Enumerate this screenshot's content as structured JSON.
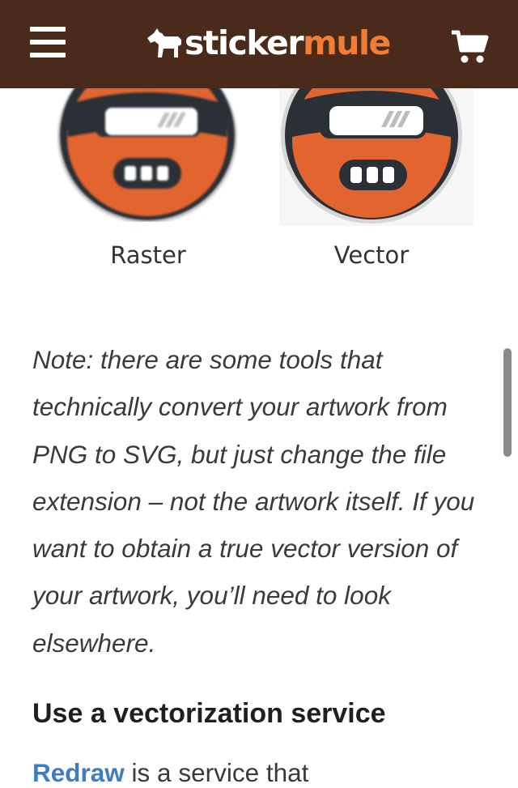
{
  "header": {
    "logo_part1": "sticker",
    "logo_part2": "mule",
    "menu_icon": "hamburger-icon",
    "cart_icon": "shopping-cart-icon"
  },
  "comparison": {
    "raster_label": "Raster",
    "vector_label": "Vector"
  },
  "note": "Note: there are some tools that technically convert your artwork from PNG to SVG, but just change the file extension – not the artwork itself. If you want to obtain a true vector version of your artwork, you’ll need to look elsewhere.",
  "section": {
    "heading": "Use a vectorization service",
    "link_text": "Redraw",
    "paragraph_start": " is a service that"
  },
  "colors": {
    "header_bg": "#4a2a1a",
    "brand_orange": "#f07e36",
    "link_blue": "#3f7cc0"
  }
}
